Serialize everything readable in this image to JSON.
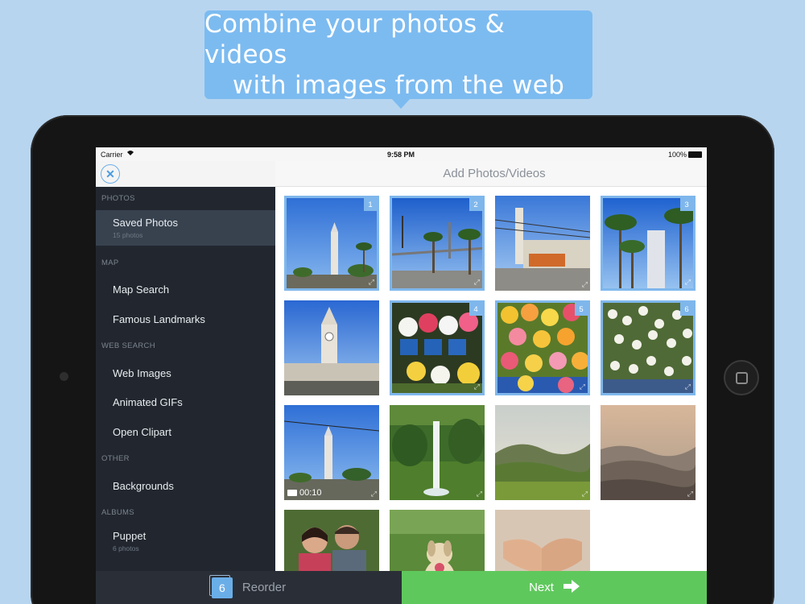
{
  "banner": {
    "line1": "Combine your photos & videos",
    "line2": "with images from the web"
  },
  "status_bar": {
    "carrier": "Carrier",
    "time": "9:58 PM",
    "battery": "100%"
  },
  "header": {
    "title": "Add Photos/Videos",
    "close_icon": "close-x-icon"
  },
  "sidebar": {
    "sections": [
      {
        "title": "PHOTOS",
        "items": [
          {
            "label": "Saved Photos",
            "sub": "15 photos",
            "selected": true
          }
        ]
      },
      {
        "title": "MAP",
        "items": [
          {
            "label": "Map Search"
          },
          {
            "label": "Famous Landmarks"
          }
        ]
      },
      {
        "title": "WEB SEARCH",
        "items": [
          {
            "label": "Web Images"
          },
          {
            "label": "Animated GIFs"
          },
          {
            "label": "Open Clipart"
          }
        ]
      },
      {
        "title": "OTHER",
        "items": [
          {
            "label": "Backgrounds"
          }
        ]
      },
      {
        "title": "ALBUMS",
        "items": [
          {
            "label": "Puppet",
            "sub": "6 photos"
          }
        ]
      }
    ]
  },
  "grid": {
    "items": [
      {
        "subject": "Ferry Building tower with palm trees",
        "selected_index": "1"
      },
      {
        "subject": "Bay Bridge with palm trees",
        "selected_index": "2"
      },
      {
        "subject": "Ferry Building with streetcar",
        "selected_index": ""
      },
      {
        "subject": "Palm trees and tall building",
        "selected_index": "3"
      },
      {
        "subject": "Ferry Building clock tower",
        "selected_index": ""
      },
      {
        "subject": "Flower stand with buckets",
        "selected_index": "4"
      },
      {
        "subject": "Colorful flower bouquets",
        "selected_index": "5"
      },
      {
        "subject": "White daisy flowers",
        "selected_index": "6"
      },
      {
        "subject": "Ferry Building video",
        "selected_index": "",
        "video_duration": "00:10"
      },
      {
        "subject": "Waterfall in green valley",
        "selected_index": ""
      },
      {
        "subject": "Green rolling hills",
        "selected_index": ""
      },
      {
        "subject": "Misty mountains at sunset",
        "selected_index": ""
      },
      {
        "subject": "Smiling couple",
        "selected_index": ""
      },
      {
        "subject": "Dog on lawn",
        "selected_index": ""
      },
      {
        "subject": "Hands on table",
        "selected_index": ""
      }
    ]
  },
  "footer": {
    "count": "6",
    "reorder_label": "Reorder",
    "next_label": "Next"
  },
  "colors": {
    "background": "#b7d5ef",
    "banner": "#7cbbf0",
    "accent": "#6aaee8",
    "sidebar": "#22272f",
    "next": "#5fc85d"
  }
}
